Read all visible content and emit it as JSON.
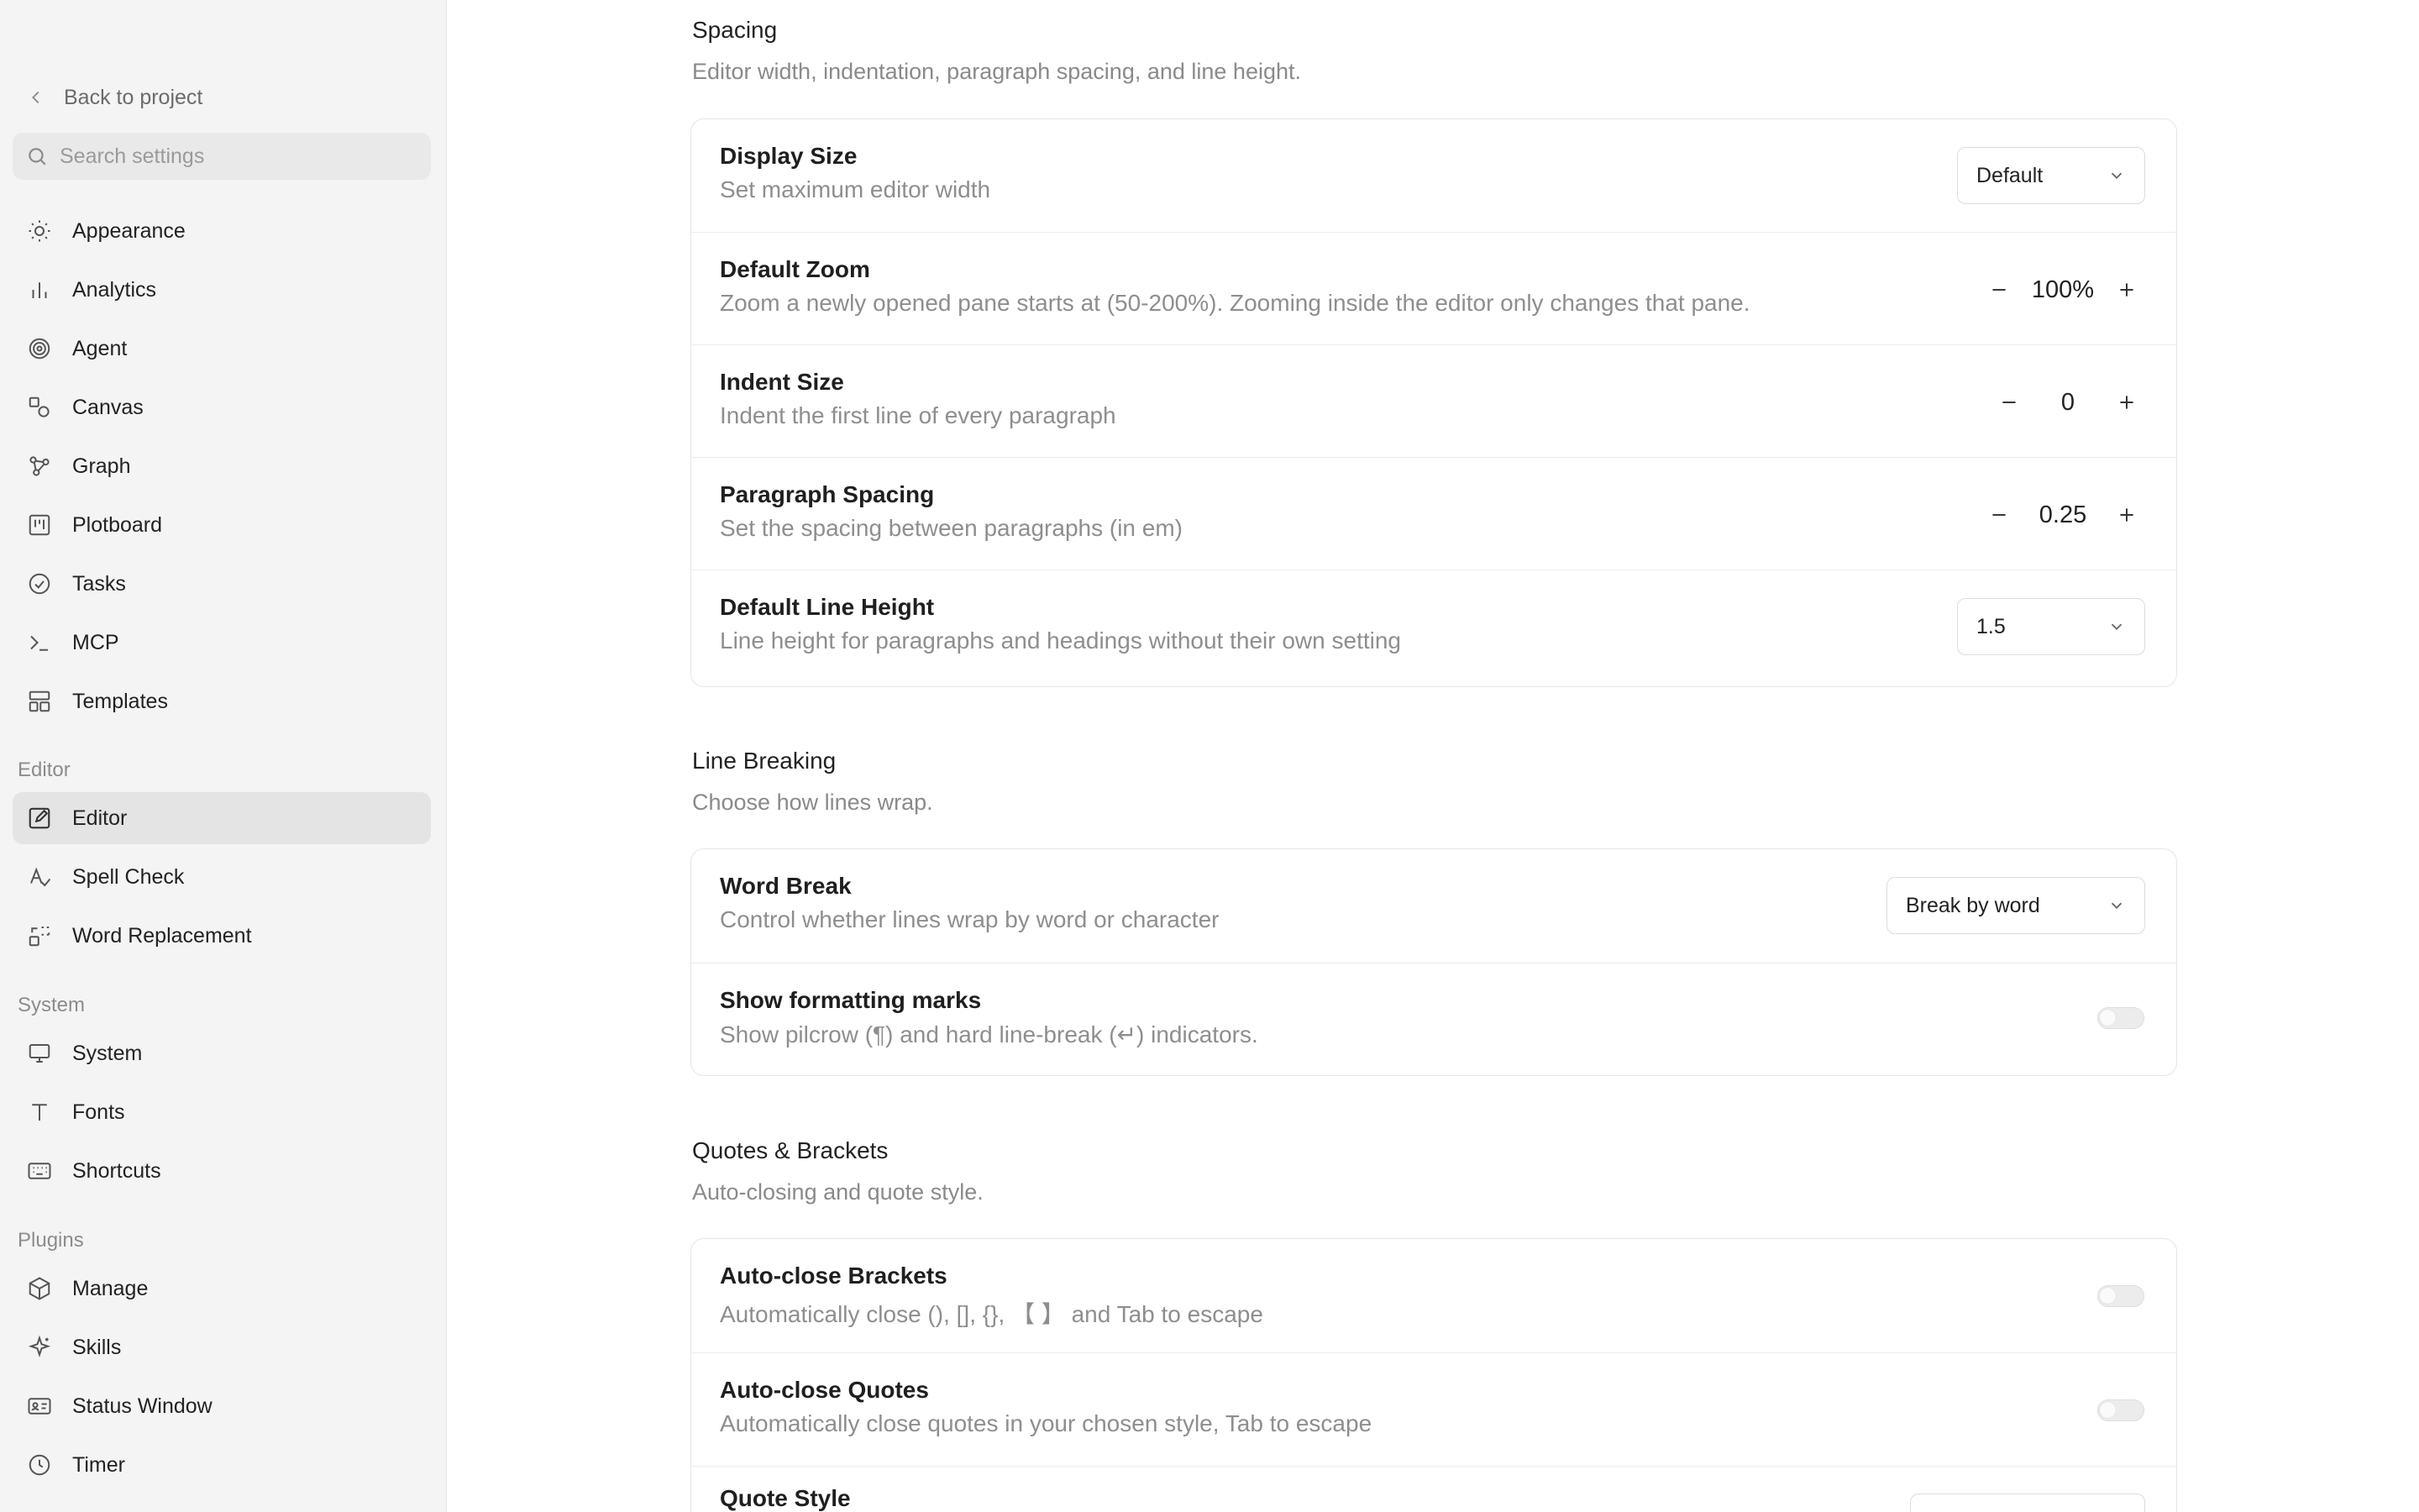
{
  "sidebar": {
    "back_label": "Back to project",
    "search_placeholder": "Search settings",
    "items_general": [
      {
        "label": "Appearance",
        "icon": "sun-icon"
      },
      {
        "label": "Analytics",
        "icon": "bar-chart-icon"
      },
      {
        "label": "Agent",
        "icon": "spiral-icon"
      },
      {
        "label": "Canvas",
        "icon": "shapes-icon"
      },
      {
        "label": "Graph",
        "icon": "graph-nodes-icon"
      },
      {
        "label": "Plotboard",
        "icon": "board-icon"
      },
      {
        "label": "Tasks",
        "icon": "check-circle-icon"
      },
      {
        "label": "MCP",
        "icon": "terminal-icon"
      },
      {
        "label": "Templates",
        "icon": "layout-icon"
      }
    ],
    "section_editor": "Editor",
    "items_editor": [
      {
        "label": "Editor",
        "icon": "edit-icon",
        "active": true
      },
      {
        "label": "Spell Check",
        "icon": "spell-check-icon"
      },
      {
        "label": "Word Replacement",
        "icon": "replace-icon"
      }
    ],
    "section_system": "System",
    "items_system": [
      {
        "label": "System",
        "icon": "monitor-icon"
      },
      {
        "label": "Fonts",
        "icon": "type-icon"
      },
      {
        "label": "Shortcuts",
        "icon": "keyboard-icon"
      }
    ],
    "section_plugins": "Plugins",
    "items_plugins": [
      {
        "label": "Manage",
        "icon": "package-icon"
      },
      {
        "label": "Skills",
        "icon": "sparkle-icon"
      },
      {
        "label": "Status Window",
        "icon": "id-card-icon"
      },
      {
        "label": "Timer",
        "icon": "clock-icon"
      }
    ]
  },
  "spacing": {
    "title": "Spacing",
    "desc": "Editor width, indentation, paragraph spacing, and line height.",
    "display_size": {
      "title": "Display Size",
      "desc": "Set maximum editor width",
      "value": "Default"
    },
    "default_zoom": {
      "title": "Default Zoom",
      "desc": "Zoom a newly opened pane starts at (50-200%). Zooming inside the editor only changes that pane.",
      "value": "100%"
    },
    "indent_size": {
      "title": "Indent Size",
      "desc": "Indent the first line of every paragraph",
      "value": "0"
    },
    "paragraph_spacing": {
      "title": "Paragraph Spacing",
      "desc": "Set the spacing between paragraphs (in em)",
      "value": "0.25"
    },
    "line_height": {
      "title": "Default Line Height",
      "desc": "Line height for paragraphs and headings without their own setting",
      "value": "1.5"
    }
  },
  "line_breaking": {
    "title": "Line Breaking",
    "desc": "Choose how lines wrap.",
    "word_break": {
      "title": "Word Break",
      "desc": "Control whether lines wrap by word or character",
      "value": "Break by word"
    },
    "formatting_marks": {
      "title": "Show formatting marks",
      "desc": "Show pilcrow (¶) and hard line-break (↵) indicators.",
      "enabled": false
    }
  },
  "quotes": {
    "title": "Quotes & Brackets",
    "desc": "Auto-closing and quote style.",
    "auto_brackets": {
      "title": "Auto-close Brackets",
      "desc": "Automatically close (), [], {}, 【 】 and Tab to escape",
      "enabled": false
    },
    "auto_quotes": {
      "title": "Auto-close Quotes",
      "desc": "Automatically close quotes in your chosen style, Tab to escape",
      "enabled": false
    },
    "quote_style": {
      "title": "Quote Style"
    }
  }
}
